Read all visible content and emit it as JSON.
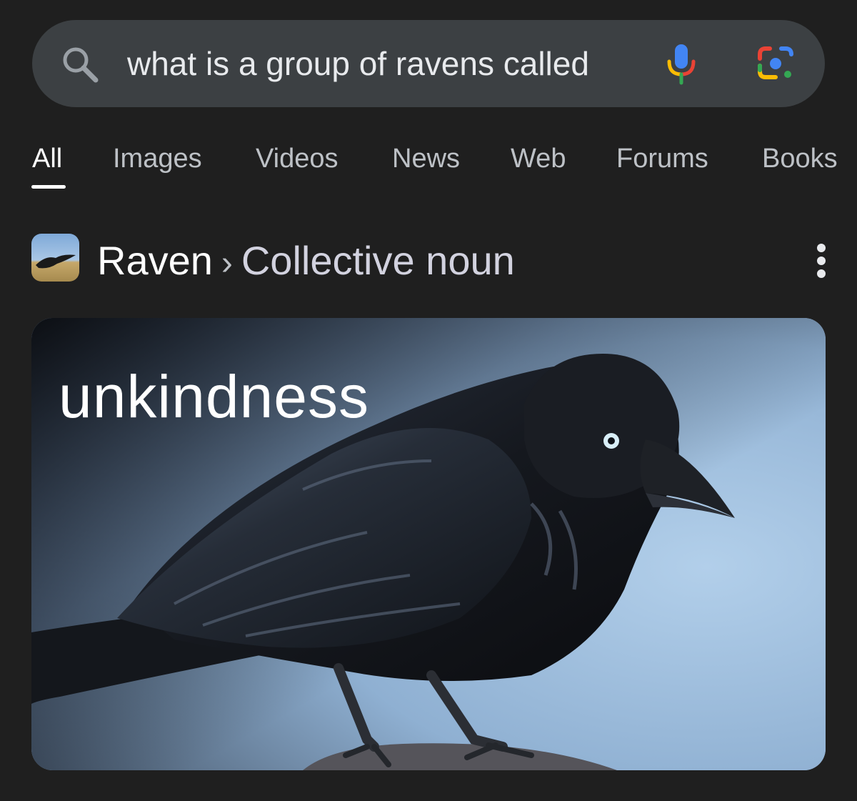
{
  "search": {
    "query": "what is a group of ravens called"
  },
  "icons": {
    "search": "search-icon",
    "mic": "mic-icon",
    "lens": "google-lens-icon",
    "more": "more-vert-icon"
  },
  "tabs": [
    {
      "label": "All",
      "active": true
    },
    {
      "label": "Images"
    },
    {
      "label": "Videos"
    },
    {
      "label": "News"
    },
    {
      "label": "Web"
    },
    {
      "label": "Forums"
    },
    {
      "label": "Books"
    }
  ],
  "result": {
    "breadcrumb_main": "Raven",
    "breadcrumb_separator": "›",
    "breadcrumb_sub": "Collective noun",
    "answer": "unkindness"
  },
  "colors": {
    "background": "#1f1f1f",
    "searchbar": "#3c4043",
    "google_blue": "#4285f4",
    "google_red": "#ea4335",
    "google_yellow": "#fbbc04",
    "google_green": "#34a853"
  }
}
